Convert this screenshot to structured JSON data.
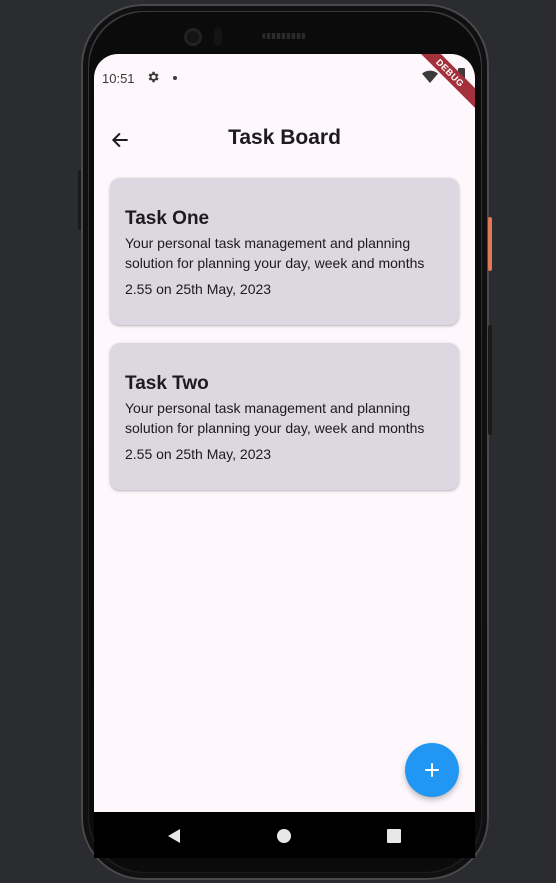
{
  "status_bar": {
    "time": "10:51",
    "debug_label": "DEBUG"
  },
  "app_bar": {
    "title": "Task Board"
  },
  "tasks": [
    {
      "title": "Task One",
      "description": "Your personal task management and planning solution for planning your day, week and months",
      "date": "2.55 on 25th May, 2023"
    },
    {
      "title": "Task Two",
      "description": "Your personal task management and planning solution for planning your day, week and months",
      "date": "2.55 on 25th May, 2023"
    }
  ],
  "fab": {
    "icon": "add-icon"
  },
  "colors": {
    "screen_background": "#fef7fb",
    "card_background": "#dcd7e0",
    "fab_background": "#2196f3",
    "debug_banner": "#a3303a",
    "text_primary": "#1c1b1f"
  }
}
